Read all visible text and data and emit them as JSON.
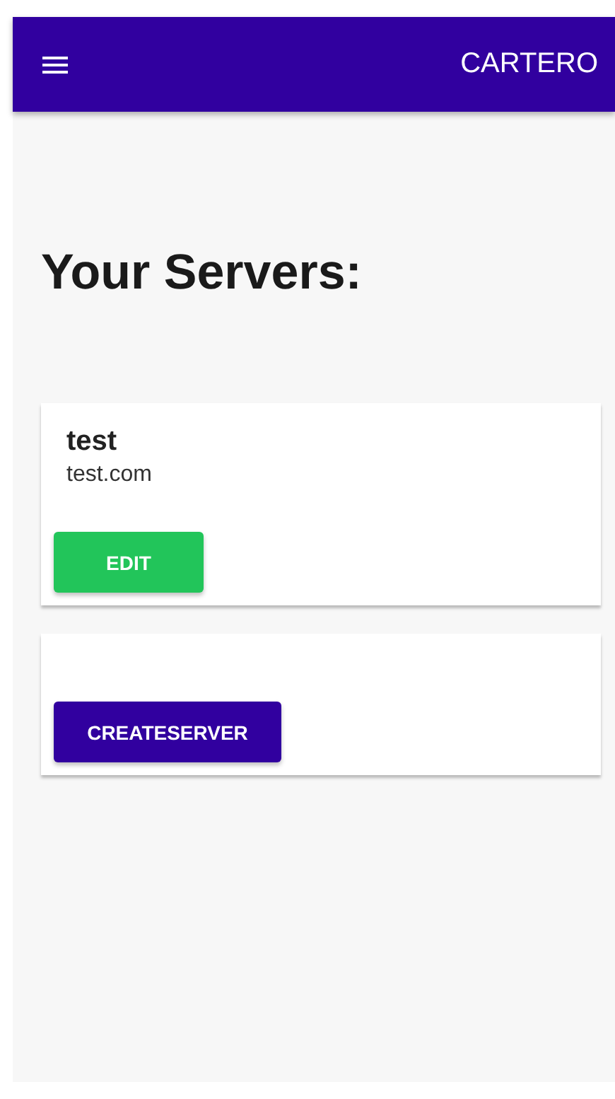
{
  "app_bar": {
    "title": "CARTERO"
  },
  "heading": "Your Servers:",
  "servers": [
    {
      "name": "test",
      "host": "test.com",
      "button": "EDIT"
    }
  ],
  "create_button": "CREATESERVER"
}
